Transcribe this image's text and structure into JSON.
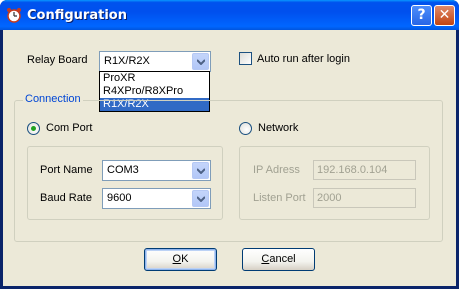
{
  "window": {
    "title": "Configuration",
    "help_label": "?",
    "close_label": "✕"
  },
  "relay_board": {
    "label": "Relay Board",
    "selected": "R1X/R2X",
    "options": [
      "ProXR",
      "R4XPro/R8XPro",
      "R1X/R2X"
    ]
  },
  "auto_run": {
    "label": "Auto run after login",
    "checked": false
  },
  "connection": {
    "legend": "Connection",
    "com_port_label": "Com Port",
    "network_label": "Network",
    "selected_mode": "Com Port"
  },
  "com": {
    "port_name_label": "Port Name",
    "port_name_value": "COM3",
    "baud_rate_label": "Baud Rate",
    "baud_rate_value": "9600"
  },
  "network": {
    "ip_label": "IP Adress",
    "ip_value": "192.168.0.104",
    "listen_port_label": "Listen Port",
    "listen_port_value": "2000"
  },
  "buttons": {
    "ok_accel": "O",
    "ok_rest": "K",
    "cancel_accel": "C",
    "cancel_rest": "ancel"
  },
  "colors": {
    "titlebar": "#0054e3",
    "dialog_bg": "#ece9d8",
    "group_legend": "#0046d5",
    "selection": "#316ac5"
  }
}
